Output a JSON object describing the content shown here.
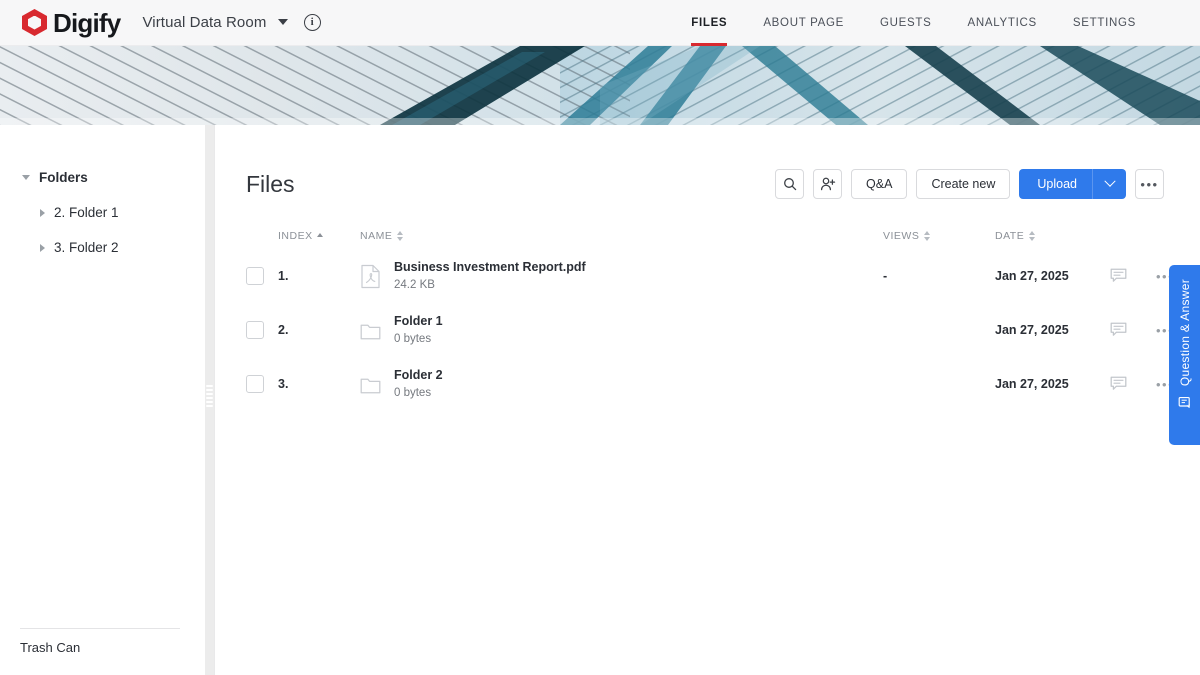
{
  "topbar": {
    "brand": "Digify",
    "brand_color": "#d8292f",
    "room_name": "Virtual Data Room",
    "info_glyph": "i",
    "nav": [
      {
        "label": "FILES",
        "active": true
      },
      {
        "label": "ABOUT PAGE",
        "active": false
      },
      {
        "label": "GUESTS",
        "active": false
      },
      {
        "label": "ANALYTICS",
        "active": false
      },
      {
        "label": "SETTINGS",
        "active": false
      }
    ]
  },
  "sidebar": {
    "root_label": "Folders",
    "items": [
      {
        "label": "2. Folder 1"
      },
      {
        "label": "3. Folder 2"
      }
    ],
    "trash_label": "Trash Can"
  },
  "main": {
    "page_title": "Files",
    "toolbar": {
      "search_icon": "search-icon",
      "invite_icon": "add-person-icon",
      "qa_label": "Q&A",
      "create_label": "Create new",
      "upload_label": "Upload",
      "upload_color": "#2f7aeb",
      "more_label": "•••"
    },
    "table": {
      "headers": {
        "index": "INDEX",
        "name": "NAME",
        "views": "VIEWS",
        "date": "DATE"
      },
      "rows": [
        {
          "index": "1.",
          "kind": "pdf",
          "name": "Business Investment Report.pdf",
          "size": "24.2 KB",
          "views": "-",
          "date": "Jan 27, 2025"
        },
        {
          "index": "2.",
          "kind": "folder",
          "name": "Folder 1",
          "size": "0 bytes",
          "views": "",
          "date": "Jan 27, 2025"
        },
        {
          "index": "3.",
          "kind": "folder",
          "name": "Folder 2",
          "size": "0 bytes",
          "views": "",
          "date": "Jan 27, 2025"
        }
      ]
    }
  },
  "qa_tab": {
    "label": "Question & Answer",
    "color": "#2f7aeb"
  }
}
